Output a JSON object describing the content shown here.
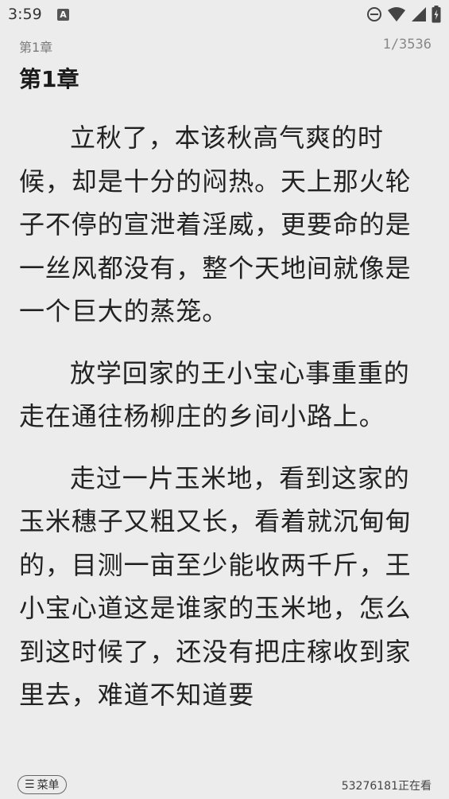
{
  "status_bar": {
    "time": "3:59",
    "notification_letter": "A",
    "icons": [
      "do-not-disturb-icon",
      "wifi-icon",
      "signal-icon",
      "battery-icon"
    ]
  },
  "header": {
    "chapter_label": "第1章",
    "page_indicator": "1/3536"
  },
  "chapter_title": "第1章",
  "paragraphs": [
    "立秋了，本该秋高气爽的时候，却是十分的闷热。天上那火轮子不停的宣泄着淫威，更要命的是一丝风都没有，整个天地间就像是一个巨大的蒸笼。",
    "放学回家的王小宝心事重重的走在通往杨柳庄的乡间小路上。",
    "走过一片玉米地，看到这家的玉米穗子又粗又长，看着就沉甸甸的，目测一亩至少能收两千斤，王小宝心道这是谁家的玉米地，怎么到这时候了，还没有把庄稼收到家里去，难道不知道要"
  ],
  "bottom_bar": {
    "menu_label": "菜单",
    "reader_count": "53276181正在看"
  }
}
